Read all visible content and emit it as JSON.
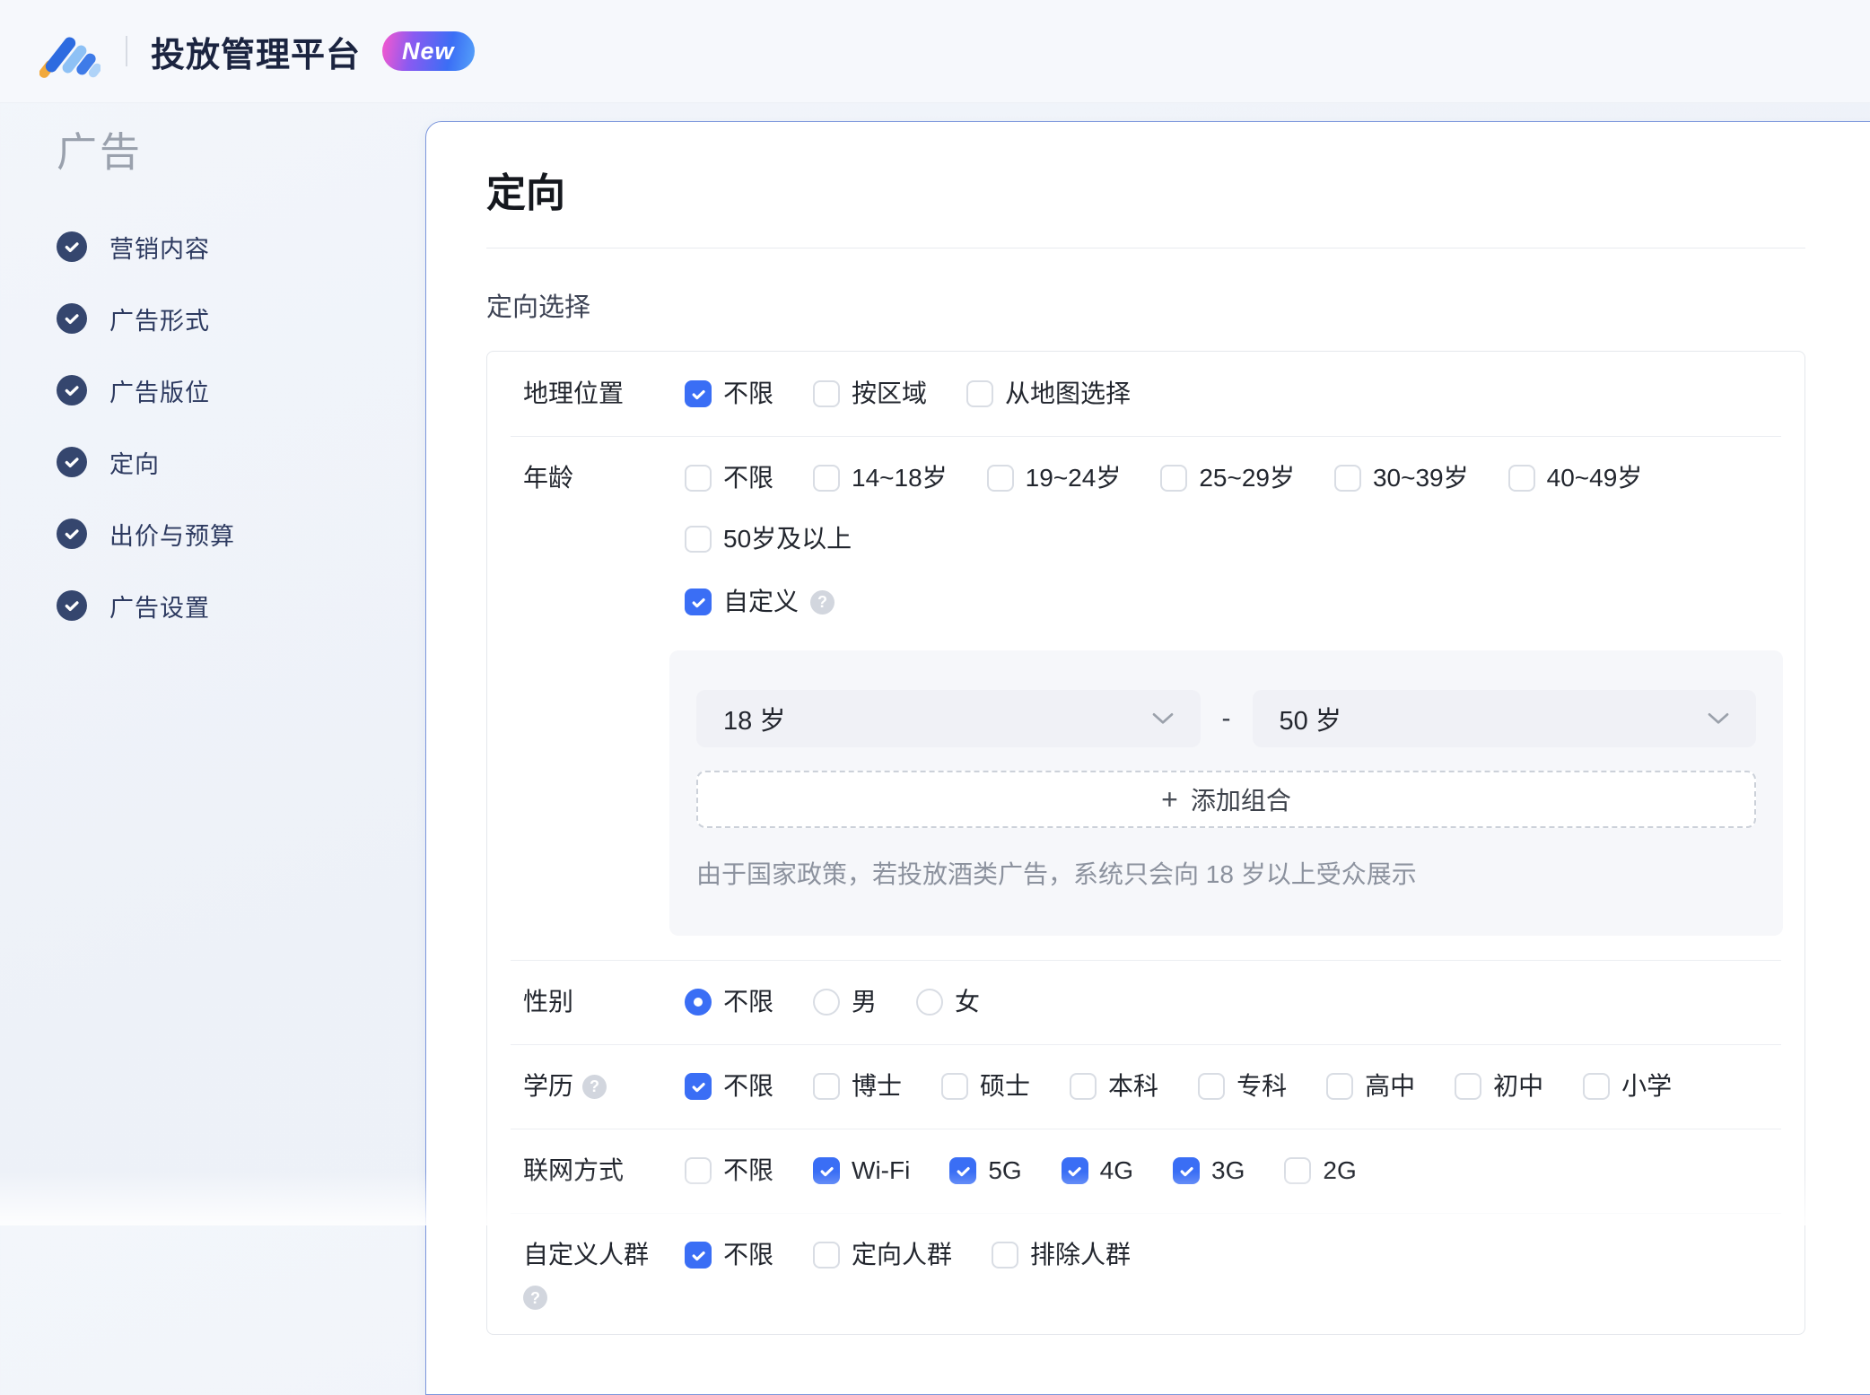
{
  "header": {
    "brand": "投放管理平台",
    "badge": "New",
    "logo_icon": "slope-bars-logo",
    "logo_colors": [
      "#F2A93B",
      "#2D6BE0",
      "#8EC1F5",
      "#3F7BE8",
      "#AFD3F8"
    ]
  },
  "sidebar": {
    "heading": "广告",
    "items": [
      {
        "slug": "marketing-content",
        "label": "营销内容",
        "status": "completed"
      },
      {
        "slug": "ad-format",
        "label": "广告形式",
        "status": "completed"
      },
      {
        "slug": "ad-placement",
        "label": "广告版位",
        "status": "completed"
      },
      {
        "slug": "targeting",
        "label": "定向",
        "status": "completed"
      },
      {
        "slug": "bid-budget",
        "label": "出价与预算",
        "status": "completed"
      },
      {
        "slug": "ad-settings",
        "label": "广告设置",
        "status": "completed"
      }
    ]
  },
  "main": {
    "title": "定向",
    "section_title": "定向选择",
    "help_glyph": "?",
    "rows": [
      {
        "slug": "geo-location",
        "label": "地理位置",
        "control": "checkbox",
        "options": [
          {
            "label": "不限",
            "checked": true
          },
          {
            "label": "按区域",
            "checked": false
          },
          {
            "label": "从地图选择",
            "checked": false
          }
        ]
      },
      {
        "slug": "age",
        "label": "年龄",
        "control": "checkbox",
        "options": [
          {
            "label": "不限",
            "checked": false
          },
          {
            "label": "14~18岁",
            "checked": false
          },
          {
            "label": "19~24岁",
            "checked": false
          },
          {
            "label": "25~29岁",
            "checked": false
          },
          {
            "label": "30~39岁",
            "checked": false
          },
          {
            "label": "40~49岁",
            "checked": false
          },
          {
            "label": "50岁及以上",
            "checked": false
          }
        ],
        "options_line2": [
          {
            "label": "自定义",
            "checked": true,
            "help": true
          }
        ],
        "custom_panel": {
          "age_from": "18 岁",
          "age_to": "50 岁",
          "range_separator": "-",
          "add_button_plus": "+",
          "add_button": "添加组合",
          "note": "由于国家政策，若投放酒类广告，系统只会向 18 岁以上受众展示"
        }
      },
      {
        "slug": "gender",
        "label": "性别",
        "control": "radio",
        "options": [
          {
            "label": "不限",
            "checked": true
          },
          {
            "label": "男",
            "checked": false
          },
          {
            "label": "女",
            "checked": false
          }
        ]
      },
      {
        "slug": "education",
        "label": "学历",
        "label_help": "inline",
        "control": "checkbox",
        "options": [
          {
            "label": "不限",
            "checked": true
          },
          {
            "label": "博士",
            "checked": false
          },
          {
            "label": "硕士",
            "checked": false
          },
          {
            "label": "本科",
            "checked": false
          },
          {
            "label": "专科",
            "checked": false
          },
          {
            "label": "高中",
            "checked": false
          },
          {
            "label": "初中",
            "checked": false
          },
          {
            "label": "小学",
            "checked": false
          }
        ]
      },
      {
        "slug": "network-type",
        "label": "联网方式",
        "control": "checkbox",
        "options": [
          {
            "label": "不限",
            "checked": false
          },
          {
            "label": "Wi-Fi",
            "checked": true
          },
          {
            "label": "5G",
            "checked": true
          },
          {
            "label": "4G",
            "checked": true
          },
          {
            "label": "3G",
            "checked": true
          },
          {
            "label": "2G",
            "checked": false
          }
        ]
      },
      {
        "slug": "custom-audience",
        "label": "自定义人群",
        "label_help": "below",
        "control": "checkbox",
        "options": [
          {
            "label": "不限",
            "checked": true
          },
          {
            "label": "定向人群",
            "checked": false
          },
          {
            "label": "排除人群",
            "checked": false
          }
        ]
      }
    ]
  },
  "colors": {
    "accent": "#3A6EF5",
    "card_border": "#7D97DC",
    "sidebar_icon": "#35466E",
    "panel_bg": "#F6F7FA",
    "select_bg": "#F0F1F6"
  }
}
